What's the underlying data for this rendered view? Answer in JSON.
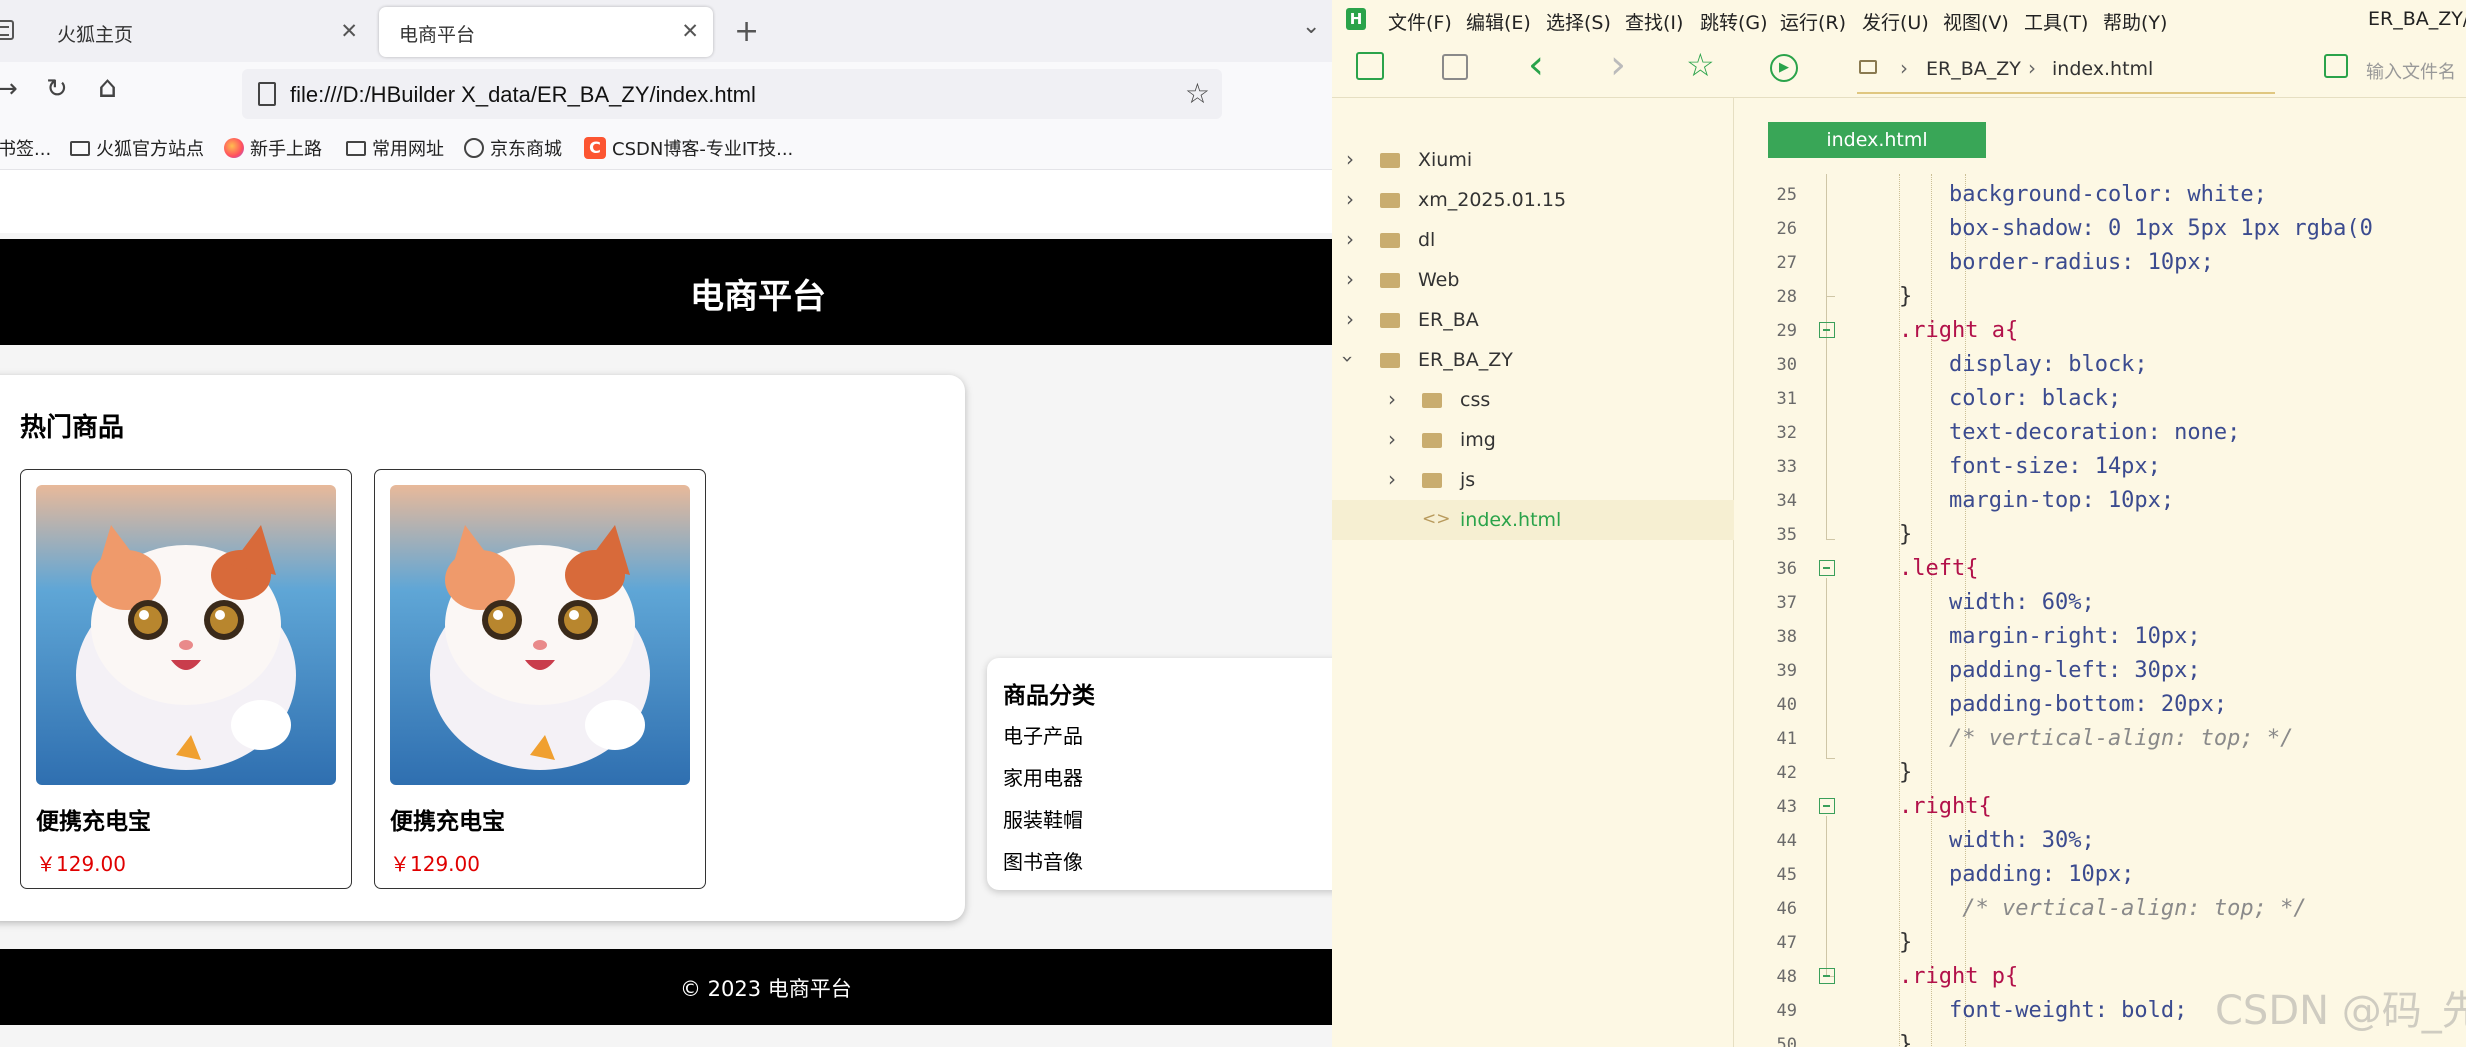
{
  "browser": {
    "tabs": [
      {
        "label": "火狐主页",
        "close": "✕"
      },
      {
        "label": "电商平台",
        "close": "✕"
      }
    ],
    "new_tab": "+",
    "all_tabs": "⌄",
    "nav": {
      "forward": "→",
      "reload": "↻",
      "home": "⌂"
    },
    "url": "file:///D:/HBuilder X_data/ER_BA_ZY/index.html",
    "bookmark_star": "☆",
    "bookmarks": [
      "书签...",
      "火狐官方站点",
      "新手上路",
      "常用网址",
      "京东商城",
      "CSDN博客-专业IT技..."
    ],
    "csdn_mark": "C"
  },
  "site": {
    "title": "电商平台",
    "hot_title": "热门商品",
    "products": [
      {
        "name": "便携充电宝",
        "price": "￥129.00"
      },
      {
        "name": "便携充电宝",
        "price": "￥129.00"
      }
    ],
    "category_title": "商品分类",
    "categories": [
      "电子产品",
      "家用电器",
      "服装鞋帽",
      "图书音像"
    ],
    "footer": "© 2023 电商平台"
  },
  "ide": {
    "logo": "H",
    "menu": [
      "文件(F)",
      "编辑(E)",
      "选择(S)",
      "查找(I)",
      "跳转(G)",
      "运行(R)",
      "发行(U)",
      "视图(V)",
      "工具(T)",
      "帮助(Y)"
    ],
    "window_title": "ER_BA_ZY/i",
    "toolbar": {
      "back": "‹",
      "forward": "›",
      "star": "☆",
      "run": "▶"
    },
    "breadcrumb": [
      "ER_BA_ZY",
      "index.html"
    ],
    "search_placeholder": "输入文件名",
    "tree": [
      {
        "label": "Xiumi"
      },
      {
        "label": "xm_2025.01.15"
      },
      {
        "label": "dl"
      },
      {
        "label": "Web"
      },
      {
        "label": "ER_BA"
      },
      {
        "label": "ER_BA_ZY"
      },
      {
        "label": "css"
      },
      {
        "label": "img"
      },
      {
        "label": "js"
      },
      {
        "label": "index.html"
      }
    ],
    "editor_tab": "index.html",
    "line_numbers": [
      "25",
      "26",
      "27",
      "28",
      "29",
      "30",
      "31",
      "32",
      "33",
      "34",
      "35",
      "36",
      "37",
      "38",
      "39",
      "40",
      "41",
      "42",
      "43",
      "44",
      "45",
      "46",
      "47",
      "48",
      "49",
      "50"
    ],
    "code_lines": [
      "background-color: white;",
      "box-shadow: 0 1px 5px 1px rgba(0",
      "border-radius: 10px;",
      "}",
      ".right a{",
      "display: block;",
      "color: black;",
      "text-decoration: none;",
      "font-size: 14px;",
      "margin-top: 10px;",
      "}",
      ".left{",
      "width: 60%;",
      "margin-right: 10px;",
      "padding-left: 30px;",
      "padding-bottom: 20px;",
      "/* vertical-align: top; */",
      "}",
      ".right{",
      "width: 30%;",
      "padding: 10px;",
      " /* vertical-align: top; */",
      "}",
      ".right p{",
      "font-weight: bold;",
      "}"
    ],
    "watermark": "CSDN @码_先生"
  }
}
